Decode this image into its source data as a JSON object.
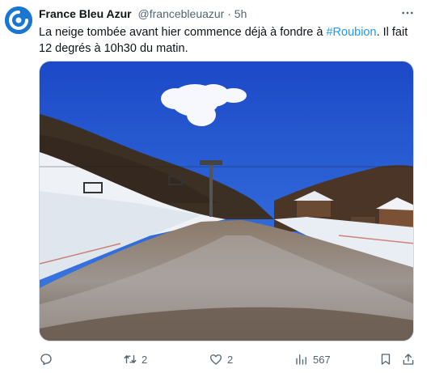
{
  "tweet": {
    "display_name": "France Bleu Azur",
    "handle": "@francebleuazur",
    "separator": "·",
    "time": "5h",
    "text_before": "La neige tombée avant hier commence déjà à fondre à ",
    "hashtag": "#Roubion",
    "text_after": ". Il fait 12 degrés à 10h30 du matin."
  },
  "icons": {
    "avatar": "france-bleu-logo",
    "more": "more-icon",
    "reply": "reply-icon",
    "retweet": "retweet-icon",
    "like": "like-icon",
    "views": "views-icon",
    "bookmark": "bookmark-icon",
    "share": "share-icon"
  },
  "actions": {
    "retweets": "2",
    "likes": "2",
    "views": "567"
  },
  "colors": {
    "brand": "#1976d2",
    "link": "#1d9bf0",
    "muted": "#536471"
  }
}
